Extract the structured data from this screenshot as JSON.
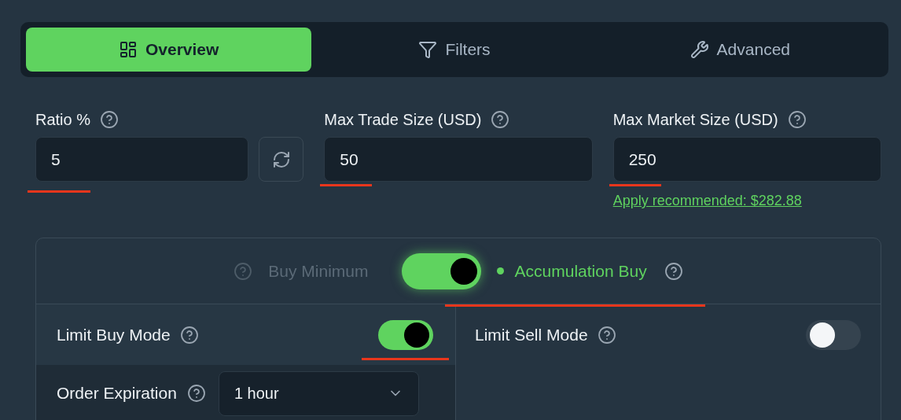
{
  "tabs": [
    {
      "label": "Overview",
      "kind": "grid",
      "selected": true
    },
    {
      "label": "Filters",
      "kind": "funnel",
      "selected": false
    },
    {
      "label": "Advanced",
      "kind": "wrench",
      "selected": false
    }
  ],
  "fields": [
    {
      "label": "Ratio %",
      "value": "5",
      "underlined": true,
      "kind": "refresh"
    },
    {
      "label": "Max Trade Size (USD)",
      "value": "50",
      "underlined": true,
      "kind": "plain"
    },
    {
      "label": "Max Market Size (USD)",
      "value": "250",
      "underlined": true,
      "kind": "link",
      "link": "Apply recommended: $282.88"
    }
  ],
  "mode_switch": {
    "left_label": "Buy Minimum",
    "right_label": "Accumulation Buy",
    "on": true,
    "underlined": true
  },
  "limit_buy": {
    "label": "Limit Buy Mode",
    "on": true,
    "underlined": true,
    "order_expiration": {
      "label": "Order Expiration",
      "value": "1 hour"
    }
  },
  "limit_sell": {
    "label": "Limit Sell Mode",
    "on": false
  }
}
